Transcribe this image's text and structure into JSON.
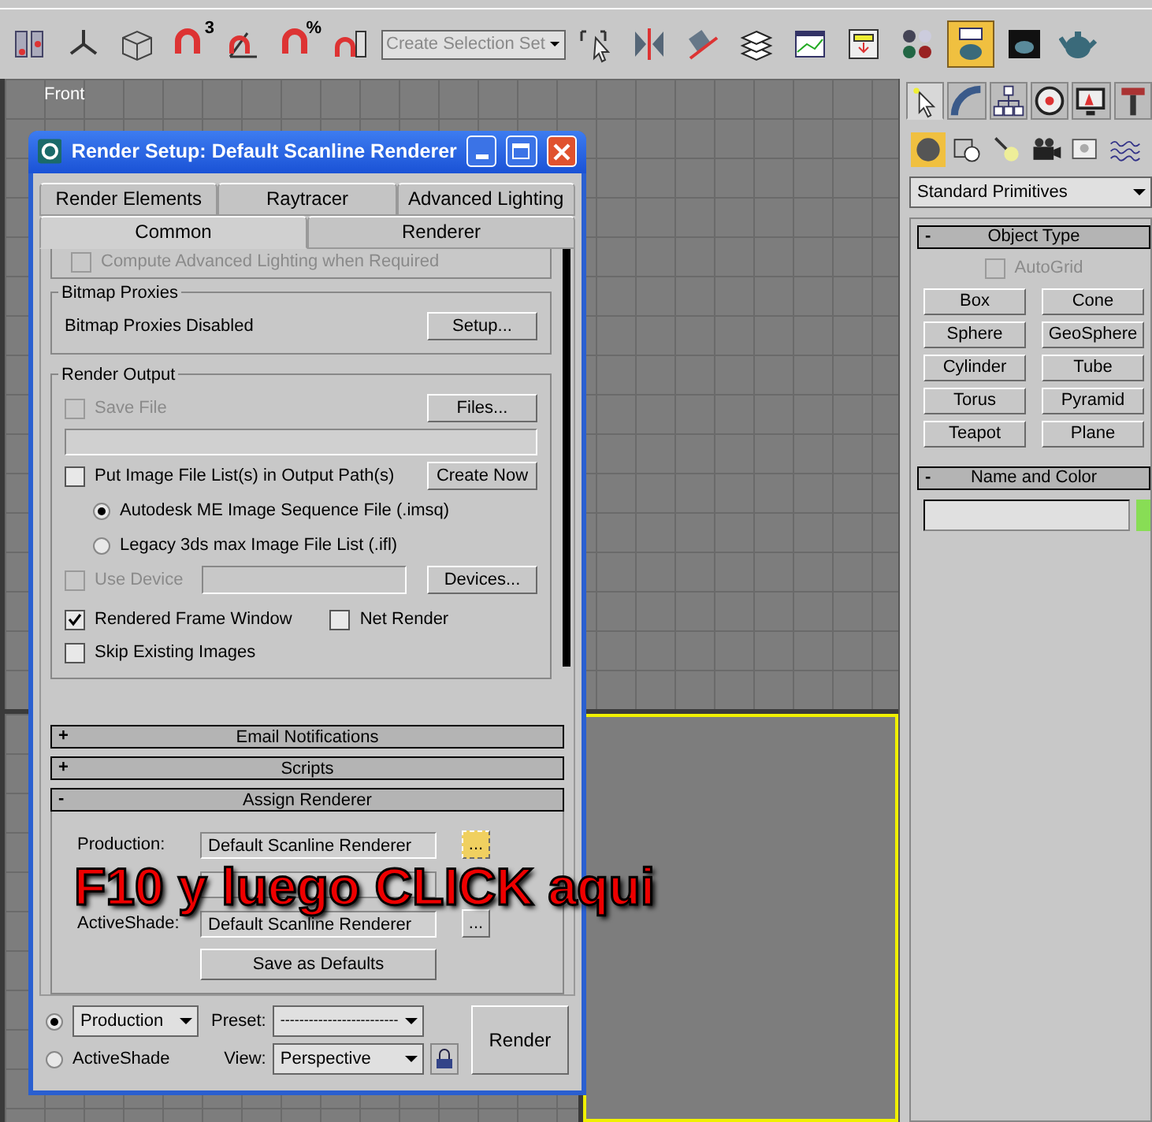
{
  "toolbar": {
    "selection_set": "Create Selection Set",
    "buttons": [
      {
        "kind": "window-crossing",
        "selected": false
      },
      {
        "kind": "axis",
        "selected": false
      },
      {
        "kind": "box3d",
        "selected": false
      },
      {
        "kind": "magnet",
        "selected": false,
        "label": "3"
      },
      {
        "kind": "angle",
        "selected": false
      },
      {
        "kind": "magnet",
        "selected": false,
        "label": "%"
      },
      {
        "kind": "spinner",
        "selected": false
      },
      {
        "kind": "edit-selection",
        "selected": false
      },
      {
        "kind": "mirror",
        "selected": false
      },
      {
        "kind": "align",
        "selected": false
      },
      {
        "kind": "layers",
        "selected": false
      },
      {
        "kind": "curve",
        "selected": false
      },
      {
        "kind": "schematic",
        "selected": false
      },
      {
        "kind": "spheres",
        "selected": false
      },
      {
        "kind": "teapot-window",
        "selected": true
      },
      {
        "kind": "frame",
        "selected": false
      },
      {
        "kind": "teapot",
        "selected": false
      }
    ]
  },
  "viewport": {
    "label": "Front"
  },
  "command_panel": {
    "tabs": [
      {
        "kind": "create",
        "selected": true
      },
      {
        "kind": "modify",
        "selected": false
      },
      {
        "kind": "hierarchy",
        "selected": false
      },
      {
        "kind": "motion",
        "selected": false
      },
      {
        "kind": "display",
        "selected": false
      },
      {
        "kind": "utilities",
        "selected": false
      }
    ],
    "categories": [
      {
        "kind": "geometry",
        "selected": true
      },
      {
        "kind": "shapes",
        "selected": false
      },
      {
        "kind": "lights",
        "selected": false
      },
      {
        "kind": "cameras",
        "selected": false
      },
      {
        "kind": "helpers",
        "selected": false
      },
      {
        "kind": "spacewarps",
        "selected": false
      }
    ],
    "dropdown": "Standard Primitives",
    "object_type": {
      "title": "Object Type",
      "sign": "-",
      "autogrid": {
        "label": "AutoGrid",
        "checked": false,
        "disabled": true
      },
      "buttons": [
        "Box",
        "Cone",
        "Sphere",
        "GeoSphere",
        "Cylinder",
        "Tube",
        "Torus",
        "Pyramid",
        "Teapot",
        "Plane"
      ]
    },
    "name_and_color": {
      "title": "Name and Color",
      "sign": "-",
      "color": "#88dd55"
    }
  },
  "dialog": {
    "title": "Render Setup: Default Scanline Renderer",
    "tab_rows": [
      [
        {
          "label": "Render Elements",
          "selected": false
        },
        {
          "label": "Raytracer",
          "selected": false
        },
        {
          "label": "Advanced Lighting",
          "selected": false
        }
      ],
      [
        {
          "label": "Common",
          "selected": true
        },
        {
          "label": "Renderer",
          "selected": false
        }
      ]
    ],
    "compute_lighting": {
      "label": "Compute Advanced Lighting when Required",
      "checked": false,
      "disabled": true
    },
    "bitmap_proxies": {
      "title": "Bitmap Proxies",
      "status": "Bitmap Proxies Disabled",
      "button": "Setup..."
    },
    "render_output": {
      "title": "Render Output",
      "save_file": {
        "label": "Save File",
        "checked": false,
        "disabled": true
      },
      "files_button": "Files...",
      "put_list": {
        "label": "Put Image File List(s) in Output Path(s)",
        "checked": false,
        "disabled": false
      },
      "create_now": "Create Now",
      "radios": [
        {
          "label": "Autodesk ME Image Sequence File (.imsq)",
          "selected": true
        },
        {
          "label": "Legacy 3ds max Image File List (.ifl)",
          "selected": false
        }
      ],
      "use_device": {
        "label": "Use Device",
        "checked": false,
        "disabled": true
      },
      "devices_button": "Devices...",
      "rendered_frame": {
        "label": "Rendered Frame Window",
        "checked": true,
        "disabled": false
      },
      "net_render": {
        "label": "Net Render",
        "checked": false,
        "disabled": false
      },
      "skip_existing": {
        "label": "Skip Existing Images",
        "checked": false,
        "disabled": false
      }
    },
    "rollouts": [
      {
        "title": "Email Notifications",
        "sign": "+"
      },
      {
        "title": "Scripts",
        "sign": "+"
      },
      {
        "title": "Assign Renderer",
        "sign": "-"
      }
    ],
    "assign": {
      "production": {
        "label": "Production:",
        "value": "Default Scanline Renderer",
        "button": "...",
        "highlighted": true
      },
      "activeshade": {
        "label": "ActiveShade:",
        "value": "Default Scanline Renderer",
        "button": "...",
        "highlighted": false
      },
      "save_defaults": "Save as Defaults"
    },
    "bottom": {
      "modes": [
        {
          "label": "Production",
          "selected": true,
          "kind": "dropdown"
        },
        {
          "label": "ActiveShade",
          "selected": false,
          "kind": "text"
        }
      ],
      "preset_label": "Preset:",
      "preset_value": "-------------------------",
      "view_label": "View:",
      "view_value": "Perspective",
      "render_button": "Render"
    }
  },
  "overlay": {
    "text": "F10 y luego CLICK aqui"
  }
}
